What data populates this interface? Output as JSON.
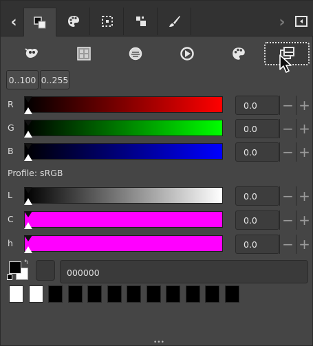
{
  "range_buttons": [
    "0..100",
    "0..255"
  ],
  "sliders": [
    {
      "label": "R",
      "value": "0.0",
      "gradient": "linear-gradient(90deg, #000000, #ff0000)"
    },
    {
      "label": "G",
      "value": "0.0",
      "gradient": "linear-gradient(90deg, #000000, #00ff00)"
    },
    {
      "label": "B",
      "value": "0.0",
      "gradient": "linear-gradient(90deg, #000000, #0000ff)"
    },
    {
      "label": "L",
      "value": "0.0",
      "gradient": "linear-gradient(90deg, #000000, #ffffff)"
    },
    {
      "label": "C",
      "value": "0.0",
      "gradient": "#ff00ff"
    },
    {
      "label": "h",
      "value": "0.0",
      "gradient": "#ff00ff"
    }
  ],
  "profile_label": "Profile: sRGB",
  "hex_value": "000000",
  "spin_minus_glyph": "−",
  "spin_plus_glyph": "+",
  "tab_left_arrow": "‹",
  "tab_right_arrow": "›",
  "swap_glyph": "↰",
  "handle_glyph": "•••",
  "history_swatches": [
    "#ffffff",
    "#ffffff",
    "#000000",
    "#000000",
    "#000000",
    "#000000",
    "#000000",
    "#000000",
    "#000000",
    "#000000",
    "#000000",
    "#000000"
  ],
  "colors": {
    "panel_bg": "#454545",
    "tabbar_bg": "#323232",
    "accent_magenta": "#ff00ff"
  },
  "icons": {
    "tabs": [
      "fg-bg-colors-icon",
      "palette-icon",
      "selection-icon",
      "paths-icon",
      "brush-icon"
    ],
    "models": [
      "gimp-wilber-icon",
      "cmyk-icon",
      "watercolor-icon",
      "wheel-icon",
      "palette-icon",
      "scales-icon"
    ]
  }
}
